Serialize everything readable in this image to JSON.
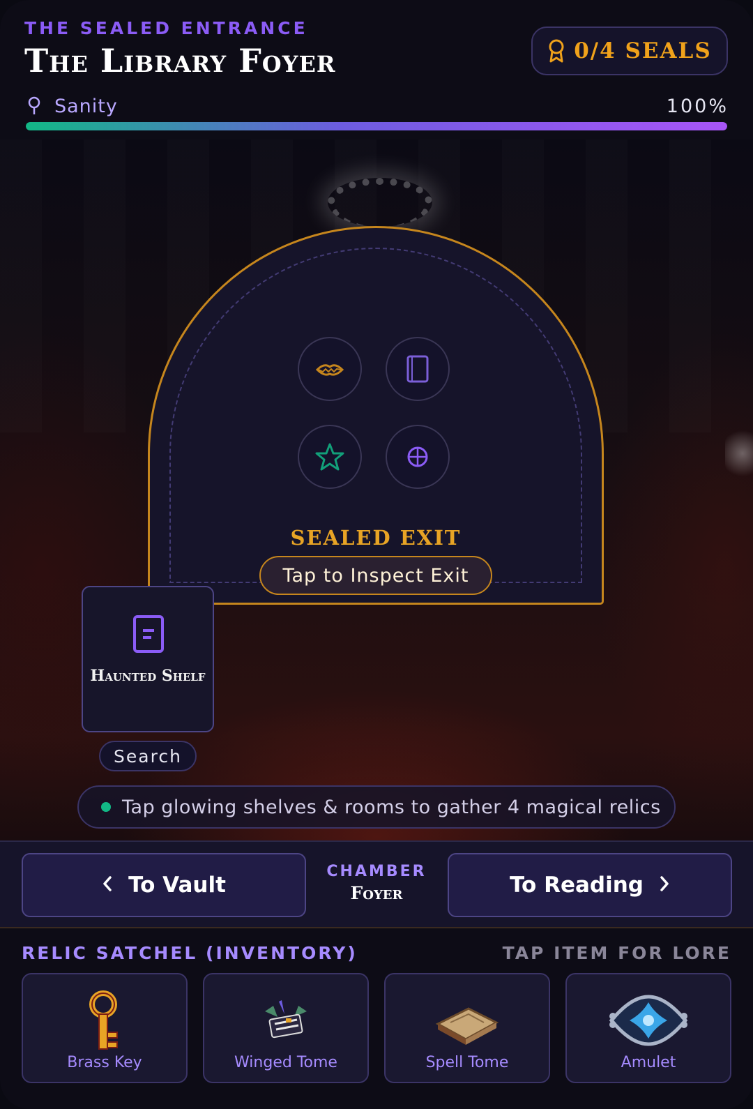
{
  "header": {
    "subtitle": "THE SEALED ENTRANCE",
    "title": "The Library Foyer",
    "seals": "0/4 SEALS"
  },
  "sanity": {
    "label": "Sanity",
    "value_text": "100%",
    "fraction": 1.0
  },
  "exit": {
    "label": "SEALED EXIT",
    "button": "Tap to Inspect Exit",
    "runes": [
      "lips-rune-icon",
      "book-rune-icon",
      "star-rune-icon",
      "globe-rune-icon"
    ]
  },
  "shelf": {
    "name": "Haunted Shelf",
    "button": "Search"
  },
  "hint": "Tap glowing shelves & rooms to gather 4 magical relics",
  "nav": {
    "left": "To Vault",
    "right": "To Reading",
    "chamber_label": "CHAMBER",
    "chamber_name": "Foyer"
  },
  "inventory": {
    "title": "RELIC SATCHEL (INVENTORY)",
    "hint": "TAP ITEM FOR LORE",
    "items": [
      {
        "label": "Brass Key",
        "icon": "brass-key-icon"
      },
      {
        "label": "Winged Tome",
        "icon": "winged-tome-icon"
      },
      {
        "label": "Spell Tome",
        "icon": "spell-tome-icon"
      },
      {
        "label": "Amulet",
        "icon": "amulet-icon"
      }
    ]
  },
  "colors": {
    "accent_purple": "#8b5cf6",
    "accent_gold": "#c6861d",
    "accent_green": "#12b886"
  }
}
